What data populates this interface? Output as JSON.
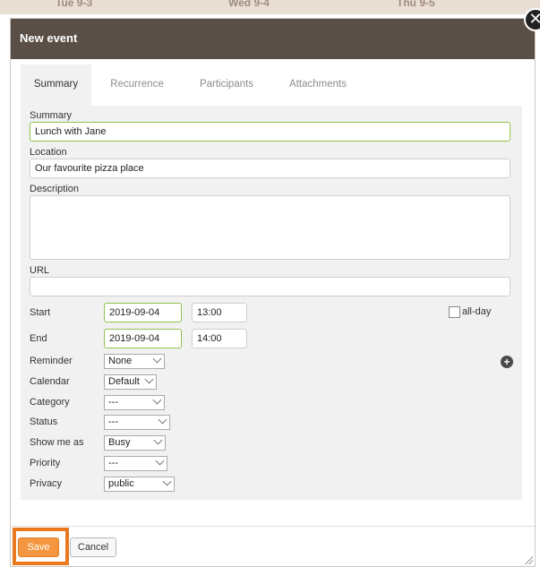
{
  "background_header": {
    "days": [
      "Tue 9-3",
      "Wed 9-4",
      "Thu 9-5"
    ]
  },
  "dialog": {
    "title": "New event",
    "close_glyph": "✕"
  },
  "tabs": [
    {
      "label": "Summary",
      "active": true
    },
    {
      "label": "Recurrence",
      "active": false
    },
    {
      "label": "Participants",
      "active": false
    },
    {
      "label": "Attachments",
      "active": false
    }
  ],
  "form": {
    "summary": {
      "label": "Summary",
      "value": "Lunch with Jane"
    },
    "location": {
      "label": "Location",
      "value": "Our favourite pizza place"
    },
    "description": {
      "label": "Description",
      "value": ""
    },
    "url": {
      "label": "URL",
      "value": ""
    },
    "start": {
      "label": "Start",
      "date": "2019-09-04",
      "time": "13:00"
    },
    "end": {
      "label": "End",
      "date": "2019-09-04",
      "time": "14:00"
    },
    "allday": {
      "label": "all-day",
      "checked": false
    },
    "reminder": {
      "label": "Reminder",
      "value": "None"
    },
    "calendar": {
      "label": "Calendar",
      "value": "Default"
    },
    "category": {
      "label": "Category",
      "value": "---"
    },
    "status": {
      "label": "Status",
      "value": "---"
    },
    "showmeas": {
      "label": "Show me as",
      "value": "Busy"
    },
    "priority": {
      "label": "Priority",
      "value": "---"
    },
    "privacy": {
      "label": "Privacy",
      "value": "public"
    }
  },
  "buttons": {
    "save": "Save",
    "cancel": "Cancel"
  },
  "colors": {
    "titlebar": "#5a4f46",
    "accent": "#f3963f",
    "focus_border": "#92c149",
    "highlight": "#e8791e"
  },
  "icons": {
    "add_reminder": "plus-circle-icon",
    "close": "close-icon",
    "resize": "resize-grip-icon"
  }
}
